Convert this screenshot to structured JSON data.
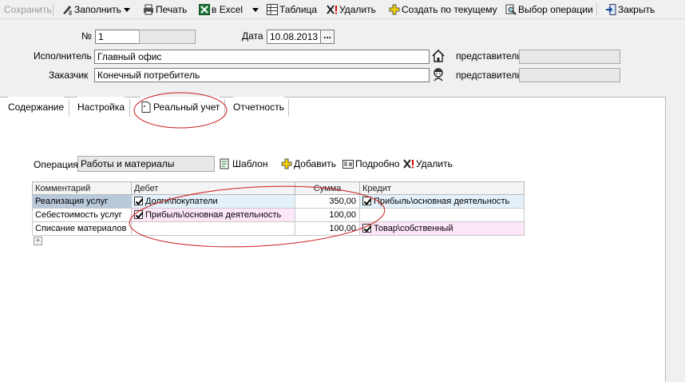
{
  "toolbar": {
    "save": "Сохранить",
    "fill": "Заполнить",
    "print": "Печать",
    "excel": "в Excel",
    "table": "Таблица",
    "delete": "Удалить",
    "create_from_current": "Создать по текущему",
    "choose_operation": "Выбор операции",
    "close": "Закрыть"
  },
  "header": {
    "number_label": "№",
    "number_value": "1",
    "date_label": "Дата",
    "date_value": "10.08.2013",
    "executor_label": "Исполнитель",
    "executor_value": "Главный офис",
    "customer_label": "Заказчик",
    "customer_value": "Конечный потребитель",
    "rep_label_1": "представитель",
    "rep_label_2": "представитель",
    "ellipsis": "..."
  },
  "tabs": [
    {
      "label": "Содержание"
    },
    {
      "label": "Настройка"
    },
    {
      "label": "Реальный учет"
    },
    {
      "label": "Отчетность"
    }
  ],
  "operation": {
    "label": "Операция",
    "value": "Работы и материалы",
    "template": "Шаблон",
    "add": "Добавить",
    "details": "Подробно",
    "delete": "Удалить"
  },
  "grid": {
    "columns": [
      "Комментарий",
      "Дебет",
      "Сумма",
      "Кредит"
    ],
    "rows": [
      {
        "comment": "Реализация услуг",
        "debit": "Долги\\покупатели",
        "amount": "350,00",
        "credit": "Прибыль\\основная деятельность"
      },
      {
        "comment": "Себестоимость услуг",
        "debit": "Прибыль\\основная деятельность",
        "amount": "100,00",
        "credit": ""
      },
      {
        "comment": "Списание материалов",
        "debit": "",
        "amount": "100,00",
        "credit": "Товар\\собственный"
      }
    ]
  },
  "colors": {
    "row_selected": "#b9c9dc",
    "row_blue": "#e4f1fb",
    "row_pink": "#fde6f7",
    "annotation": "#cc1a1a"
  }
}
